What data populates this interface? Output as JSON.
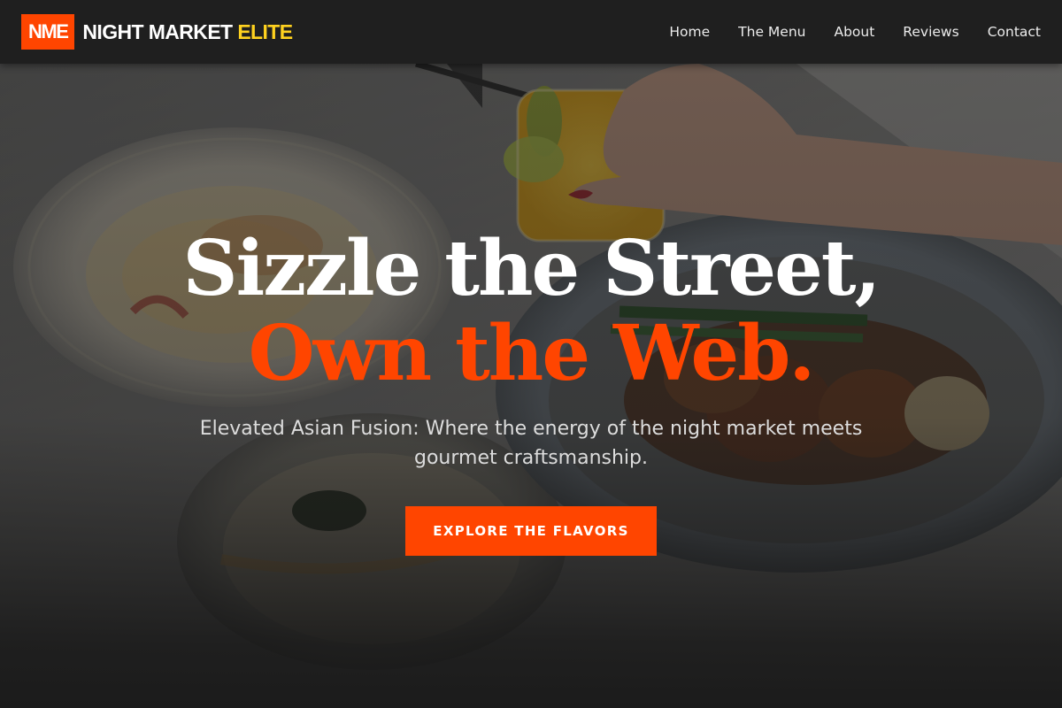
{
  "brand": {
    "logo_text": "NME",
    "name_main": "NIGHT MARKET",
    "name_accent": "ELITE"
  },
  "nav": {
    "links": [
      "Home",
      "The Menu",
      "About",
      "Reviews",
      "Contact"
    ]
  },
  "hero": {
    "headline_line1": "Sizzle the Street,",
    "headline_line2": "Own the Web.",
    "subtitle": "Elevated Asian Fusion: Where the energy of the night market meets gourmet craftsmanship.",
    "cta_label": "EXPLORE THE FLAVORS"
  },
  "colors": {
    "accent": "#ff4500",
    "brand_accent": "#ffd21f",
    "navbar_bg": "#1f1f1f",
    "hero_overlay": "#141414"
  },
  "icons": [
    "logo-badge"
  ]
}
